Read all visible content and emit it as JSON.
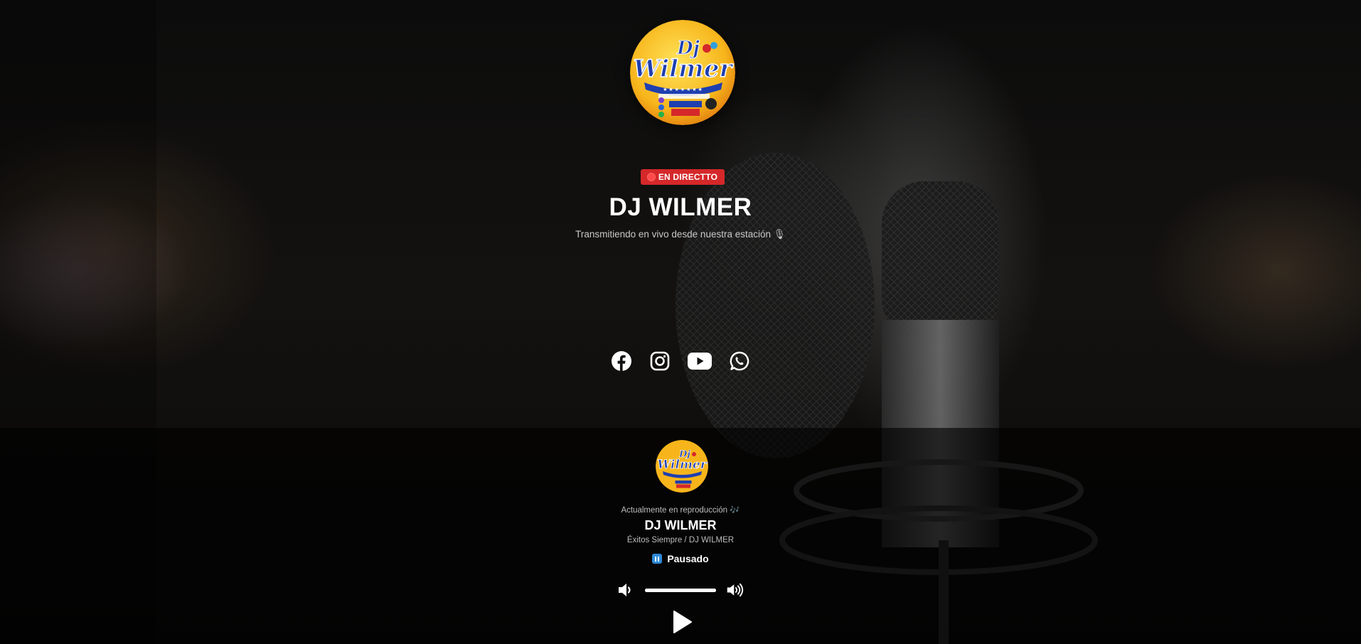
{
  "station": {
    "live_badge": "EN DIRECTTO",
    "name": "DJ WILMER",
    "tagline": "Transmitiendo en vivo desde nuestra estación 🎙",
    "logo": {
      "title": "Dj Wilmer",
      "url": "https://wilmerdjgoldclasica.com",
      "escuchanos": "ESCUCHANOS",
      "envivo": "EN-VIVO"
    }
  },
  "socials": [
    {
      "name": "facebook-icon"
    },
    {
      "name": "instagram-icon"
    },
    {
      "name": "youtube-icon"
    },
    {
      "name": "whatsapp-icon"
    }
  ],
  "player": {
    "now_playing_label": "Actualmente en reproducción 🎶",
    "title": "DJ WILMER",
    "artist": "Éxitos Siempre / DJ WILMER",
    "status": "Pausado",
    "volume": 1.0
  },
  "colors": {
    "badge": "#d5282a",
    "logo_yellow": "#f7c21b",
    "logo_blue": "#1f3fb0"
  }
}
